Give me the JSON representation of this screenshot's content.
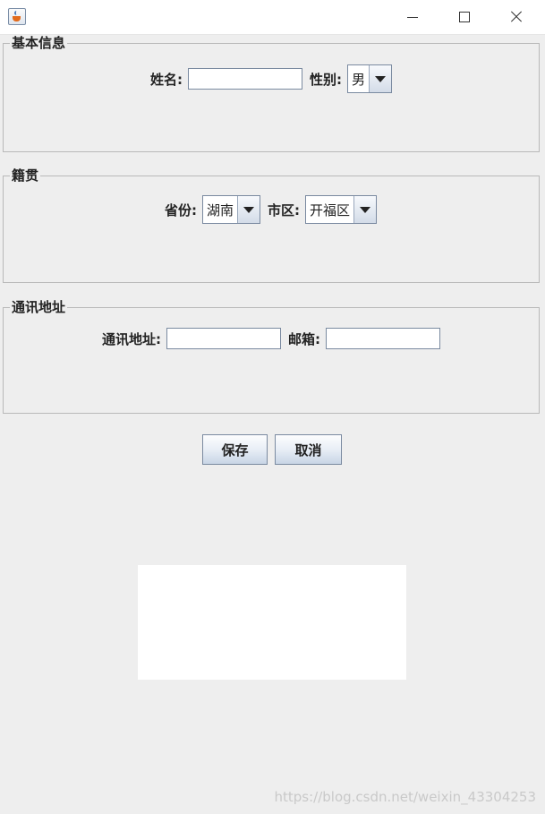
{
  "window": {
    "icon": "java-cup-icon"
  },
  "basic_info": {
    "title": "基本信息",
    "name_label": "姓名:",
    "name_value": "",
    "gender_label": "性别:",
    "gender_value": "男"
  },
  "native_place": {
    "title": "籍贯",
    "province_label": "省份:",
    "province_value": "湖南",
    "district_label": "市区:",
    "district_value": "开福区"
  },
  "contact": {
    "title": "通讯地址",
    "address_label": "通讯地址:",
    "address_value": "",
    "email_label": "邮箱:",
    "email_value": ""
  },
  "actions": {
    "save_label": "保存",
    "cancel_label": "取消"
  },
  "watermark": "https://blog.csdn.net/weixin_43304253"
}
